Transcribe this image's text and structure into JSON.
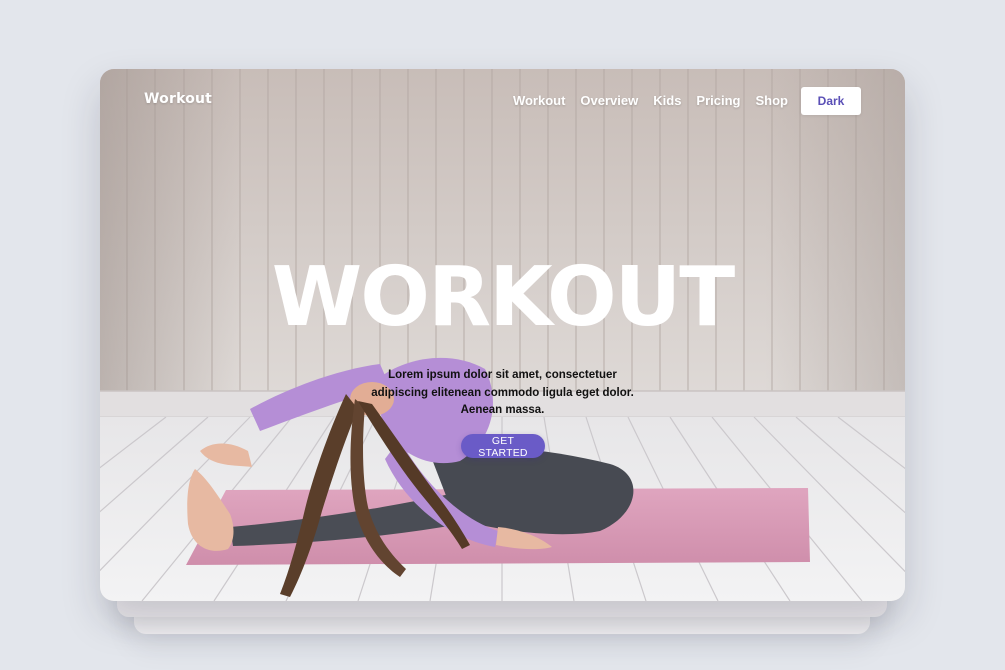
{
  "nav": {
    "logo": "Workout",
    "links": [
      "Workout",
      "Overview",
      "Kids",
      "Pricing",
      "Shop"
    ],
    "theme_button": "Dark"
  },
  "hero": {
    "title": "WORKOUT",
    "description": "Lorem ipsum dolor sit amet, consectetuer adipiscing elitenean commodo ligula eget dolor. Aenean massa.",
    "cta": "GET STARTED"
  },
  "colors": {
    "accent": "#6a5bc7",
    "background": "#e3e6ec",
    "mat": "#d99ab5",
    "shirt": "#b992d8"
  }
}
